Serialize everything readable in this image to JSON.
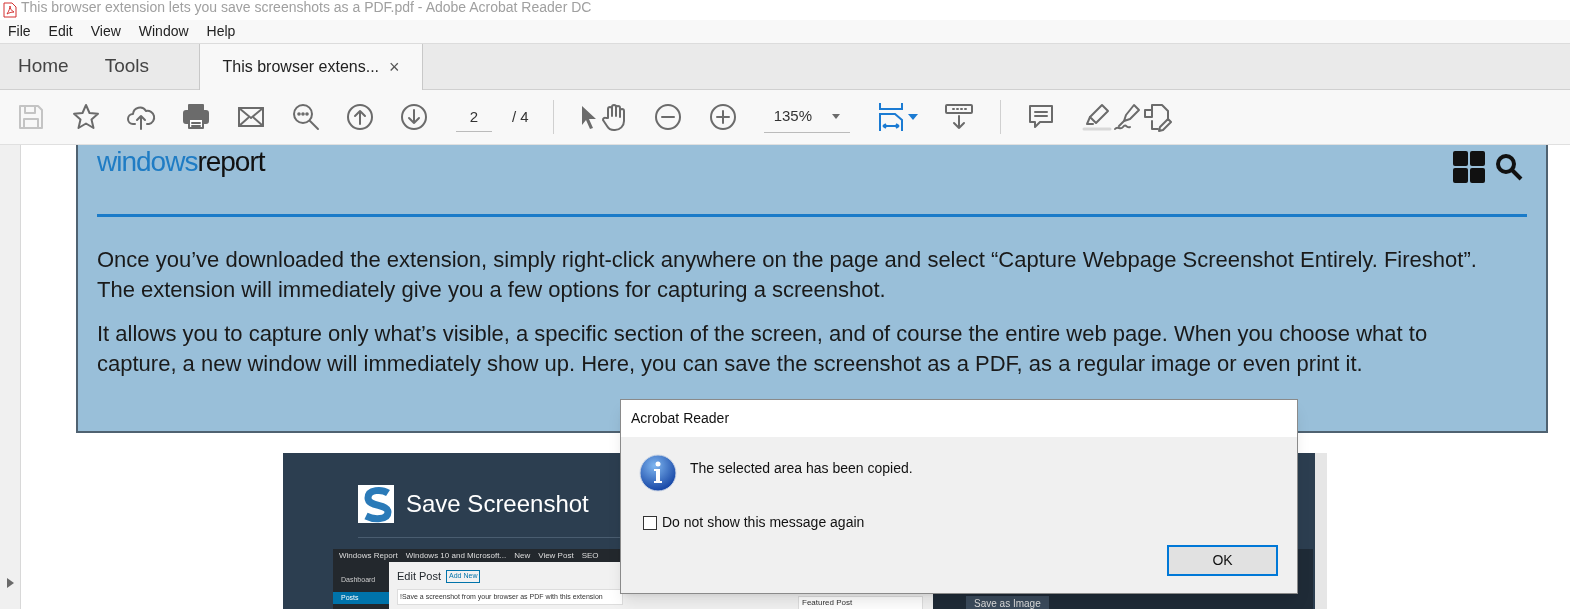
{
  "window": {
    "title": "This browser extension lets you save screenshots as a PDF.pdf - Adobe Acrobat Reader DC"
  },
  "menu": [
    "File",
    "Edit",
    "View",
    "Window",
    "Help"
  ],
  "tabs": [
    {
      "label": "Home",
      "selected": false
    },
    {
      "label": "Tools",
      "selected": false
    },
    {
      "label": "This browser extens...",
      "selected": true,
      "close": "×"
    }
  ],
  "toolbar_left": [
    {
      "kind": "save",
      "disabled": true
    },
    {
      "kind": "star",
      "disabled": false
    },
    {
      "kind": "upload",
      "disabled": false
    },
    {
      "kind": "print",
      "disabled": false
    },
    {
      "kind": "mail",
      "disabled": false
    },
    {
      "kind": "find",
      "disabled": false
    }
  ],
  "page_nav": {
    "current": "2",
    "total": "/ 4"
  },
  "zoom": {
    "value": "135%"
  },
  "document": {
    "logo": [
      "windows",
      "report"
    ],
    "paragraphs": [
      "Once you’ve downloaded the extension, simply right-click anywhere on the page and select “Capture Webpage Screenshot Entirely. Fireshot”. The extension will immediately give you a few options for capturing a screenshot.",
      "It allows you to capture only what’s visible, a specific section of the screen, and of course the entire web page. When you choose what to capture, a new window will immediately show up. Here, you can save the screenshot as a PDF, as a regular image or even print it."
    ],
    "embedded_screenshot": {
      "heading": "Save Screenshot",
      "admin_bar": [
        "Windows Report",
        "Windows 10 and Microsoft...",
        "New",
        "View Post",
        "SEO"
      ],
      "sidebar": [
        {
          "label": "Dashboard",
          "selected": false
        },
        {
          "label": "Posts",
          "selected": true
        }
      ],
      "edit_title": "Edit Post",
      "add_new": "Add New",
      "post_title": "!Save a screenshot from your browser as PDF with this extension",
      "side_box": "Featured Post",
      "side_button": "Save as Image"
    }
  },
  "dialog": {
    "title": "Acrobat Reader",
    "message": "The selected area has been copied.",
    "checkbox": {
      "label": "Do not show this message again",
      "checked": false
    },
    "button": "OK"
  }
}
